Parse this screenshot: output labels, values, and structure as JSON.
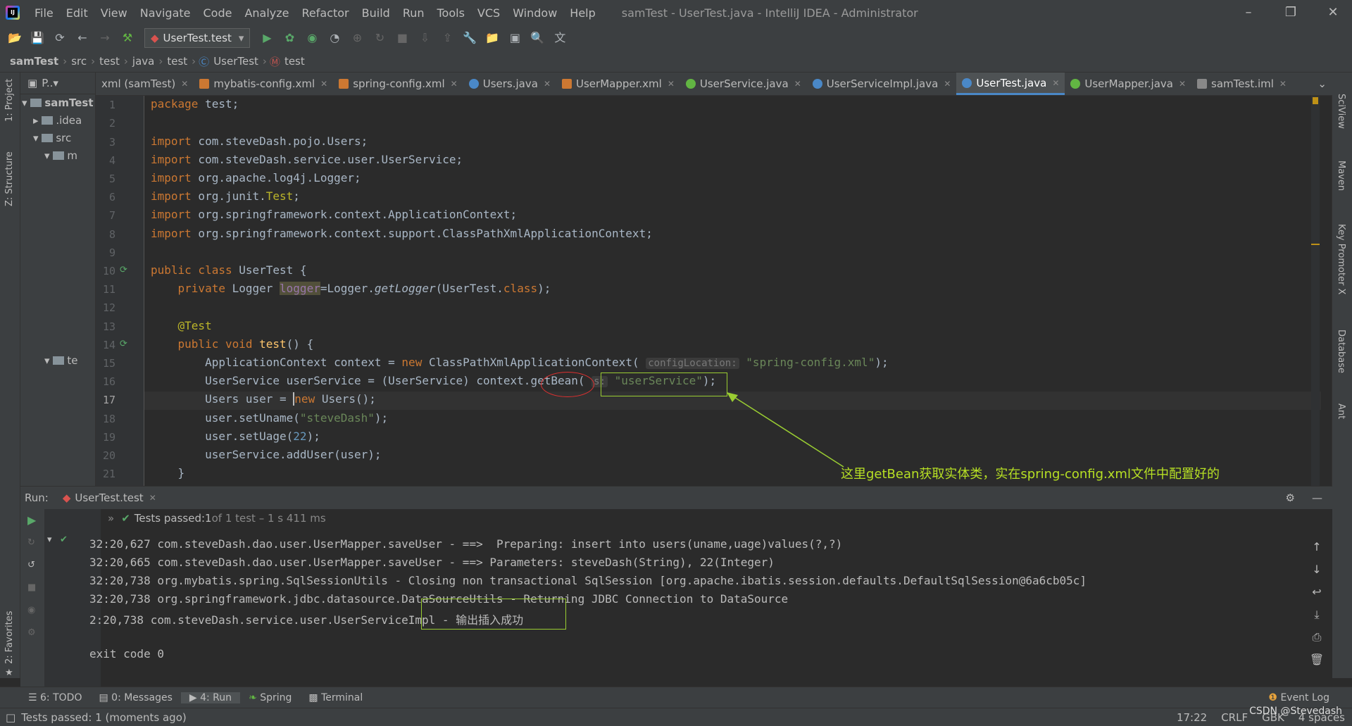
{
  "menu": [
    "File",
    "Edit",
    "View",
    "Navigate",
    "Code",
    "Analyze",
    "Refactor",
    "Build",
    "Run",
    "Tools",
    "VCS",
    "Window",
    "Help"
  ],
  "window_title": "samTest - UserTest.java - IntelliJ IDEA - Administrator",
  "toolbar": {
    "run_config": "UserTest.test"
  },
  "breadcrumbs": [
    "samTest",
    "src",
    "test",
    "java",
    "test",
    "UserTest",
    "test"
  ],
  "left_tool_windows": {
    "project": "1: Project",
    "structure": "Z: Structure",
    "favorites": "2: Favorites"
  },
  "right_tool_windows": [
    "SciView",
    "Maven",
    "Key Promoter X",
    "Database",
    "Ant"
  ],
  "project_panel": {
    "title": "P..▾",
    "tree": [
      "samTest",
      ".idea",
      "src",
      "m",
      "te"
    ]
  },
  "tabs": [
    {
      "label": "xml (samTest)",
      "color": "#cc7832"
    },
    {
      "label": "mybatis-config.xml",
      "color": "#cc7832"
    },
    {
      "label": "spring-config.xml",
      "color": "#cc7832"
    },
    {
      "label": "Users.java",
      "color": "#4a88c7"
    },
    {
      "label": "UserMapper.xml",
      "color": "#cc7832"
    },
    {
      "label": "UserService.java",
      "color": "#62b543"
    },
    {
      "label": "UserServiceImpl.java",
      "color": "#4a88c7"
    },
    {
      "label": "UserTest.java",
      "color": "#4a88c7",
      "active": true
    },
    {
      "label": "UserMapper.java",
      "color": "#62b543"
    },
    {
      "label": "samTest.iml",
      "color": "#888888"
    }
  ],
  "editor": {
    "line_numbers": [
      "1",
      "2",
      "3",
      "4",
      "5",
      "6",
      "7",
      "8",
      "9",
      "10",
      "11",
      "12",
      "13",
      "14",
      "15",
      "16",
      "17",
      "18",
      "19",
      "20",
      "21"
    ],
    "line1_kw": "package",
    "line1_rest": " test;",
    "import_kw": "import",
    "imports": [
      " com.steveDash.pojo.Users;",
      " com.steveDash.service.user.UserService;",
      " org.apache.log4j.Logger;",
      " org.junit.",
      " org.springframework.context.ApplicationContext;",
      " org.springframework.context.support.ClassPathXmlApplicationContext;"
    ],
    "junit_test": "Test",
    "class_kw": "public class",
    "class_name": " UserTest {",
    "logger_kw": "private",
    "logger_type": " Logger ",
    "logger_field": "logger",
    "logger_eq": "=Logger.",
    "logger_method": "getLogger",
    "logger_arg": "(UserTest.",
    "class_lit": "class",
    "logger_end": ");",
    "annotation": "@Test",
    "method_kw": "public void",
    "method_name": " test",
    "method_end": "() {",
    "ctx_decl": "ApplicationContext context = ",
    "new_kw": "new",
    "ctx_ctor": " ClassPathXmlApplicationContext(",
    "ctx_hint": "configLocation:",
    "ctx_arg": "\"spring-config.xml\"",
    "ctx_end": ");",
    "svc_decl": "UserService userService = (UserService) context.",
    "svc_method": "getBean",
    "svc_paren": "(",
    "svc_hint": "s:",
    "svc_arg": "\"userService\"",
    "svc_end": ");",
    "user_decl": "Users user = ",
    "user_ctor": " Users();",
    "uname_call": "user.setUname(",
    "uname_arg": "\"steveDash\"",
    "uname_end": ");",
    "uage_call": "user.setUage(",
    "uage_arg": "22",
    "uage_end": ");",
    "add_call": "userService.addUser(user);",
    "close_brace": "}"
  },
  "run_panel": {
    "label": "Run:",
    "config": "UserTest.test",
    "status_prefix": "Tests passed: ",
    "status_count": "1",
    "status_detail": " of 1 test – 1 s 411 ms",
    "console": [
      "32:20,627 com.steveDash.dao.user.UserMapper.saveUser - ==>  Preparing: insert into users(uname,uage)values(?,?)",
      "32:20,665 com.steveDash.dao.user.UserMapper.saveUser - ==> Parameters: steveDash(String), 22(Integer)",
      "32:20,738 org.mybatis.spring.SqlSessionUtils - Closing non transactional SqlSession [org.apache.ibatis.session.defaults.DefaultSqlSession@6a6cb05c]",
      "32:20,738 org.springframework.jdbc.datasource.DataSourceUtils - Returning JDBC Connection to DataSource",
      "2:20,738 com.steveDash.service.user.UserServiceImpl - 输出插入成功",
      "",
      "exit code 0"
    ]
  },
  "bottom_tabs": [
    "6: TODO",
    "0: Messages",
    "4: Run",
    "Spring",
    "Terminal"
  ],
  "event_log": "Event Log",
  "status": {
    "message": "Tests passed: 1 (moments ago)",
    "position": "17:22",
    "line_sep": "CRLF",
    "encoding": "GBK",
    "indent": "4 spaces",
    "watermark": "CSDN @Stevedash"
  },
  "callout": "这里getBean获取实体类，实在spring-config.xml文件中配置好的",
  "colors": {
    "accent": "#4a88c7",
    "annotation": "#9acd32",
    "callout": "#b7e024",
    "circle": "#e03030"
  }
}
